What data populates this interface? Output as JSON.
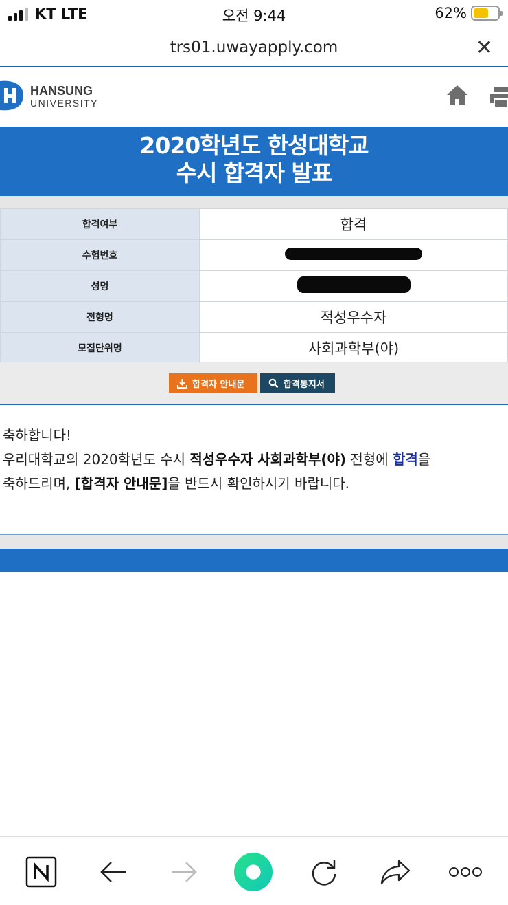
{
  "status_bar": {
    "carrier": "KT LTE",
    "time": "오전 9:44",
    "battery_percent": "62%",
    "battery_level": 0.62
  },
  "browser": {
    "url": "trs01.uwayapply.com",
    "close_icon": "close-icon"
  },
  "site": {
    "logo_name": "HANSUNG",
    "logo_sub": "UNIVERSITY",
    "title_line1": "2020학년도 한성대학교",
    "title_line2": "수시 합격자 발표"
  },
  "result_table": {
    "rows": [
      {
        "label": "합격여부",
        "value": "합격"
      },
      {
        "label": "수험번호",
        "value": ""
      },
      {
        "label": "성명",
        "value": ""
      },
      {
        "label": "전형명",
        "value": "적성우수자"
      },
      {
        "label": "모집단위명",
        "value": "사회과학부(야)"
      }
    ]
  },
  "buttons": {
    "guide_label": "합격자 안내문",
    "notice_label": "합격통지서"
  },
  "message": {
    "line1": "축하합니다!",
    "l2_a": "우리대학교의 2020학년도 수시 ",
    "l2_b": "적성우수자 사회과학부(야)",
    "l2_c": " 전형에 ",
    "l2_d": "합격",
    "l2_e": "을",
    "l3_a": "축하드리며, ",
    "l3_b": "[합격자 안내문]",
    "l3_c": "을 반드시 확인하시기 바랍니다."
  },
  "colors": {
    "brand_blue": "#1f6fc4",
    "orange": "#e8731c",
    "navy": "#1c4864",
    "pass_text": "#1b2fa0"
  }
}
